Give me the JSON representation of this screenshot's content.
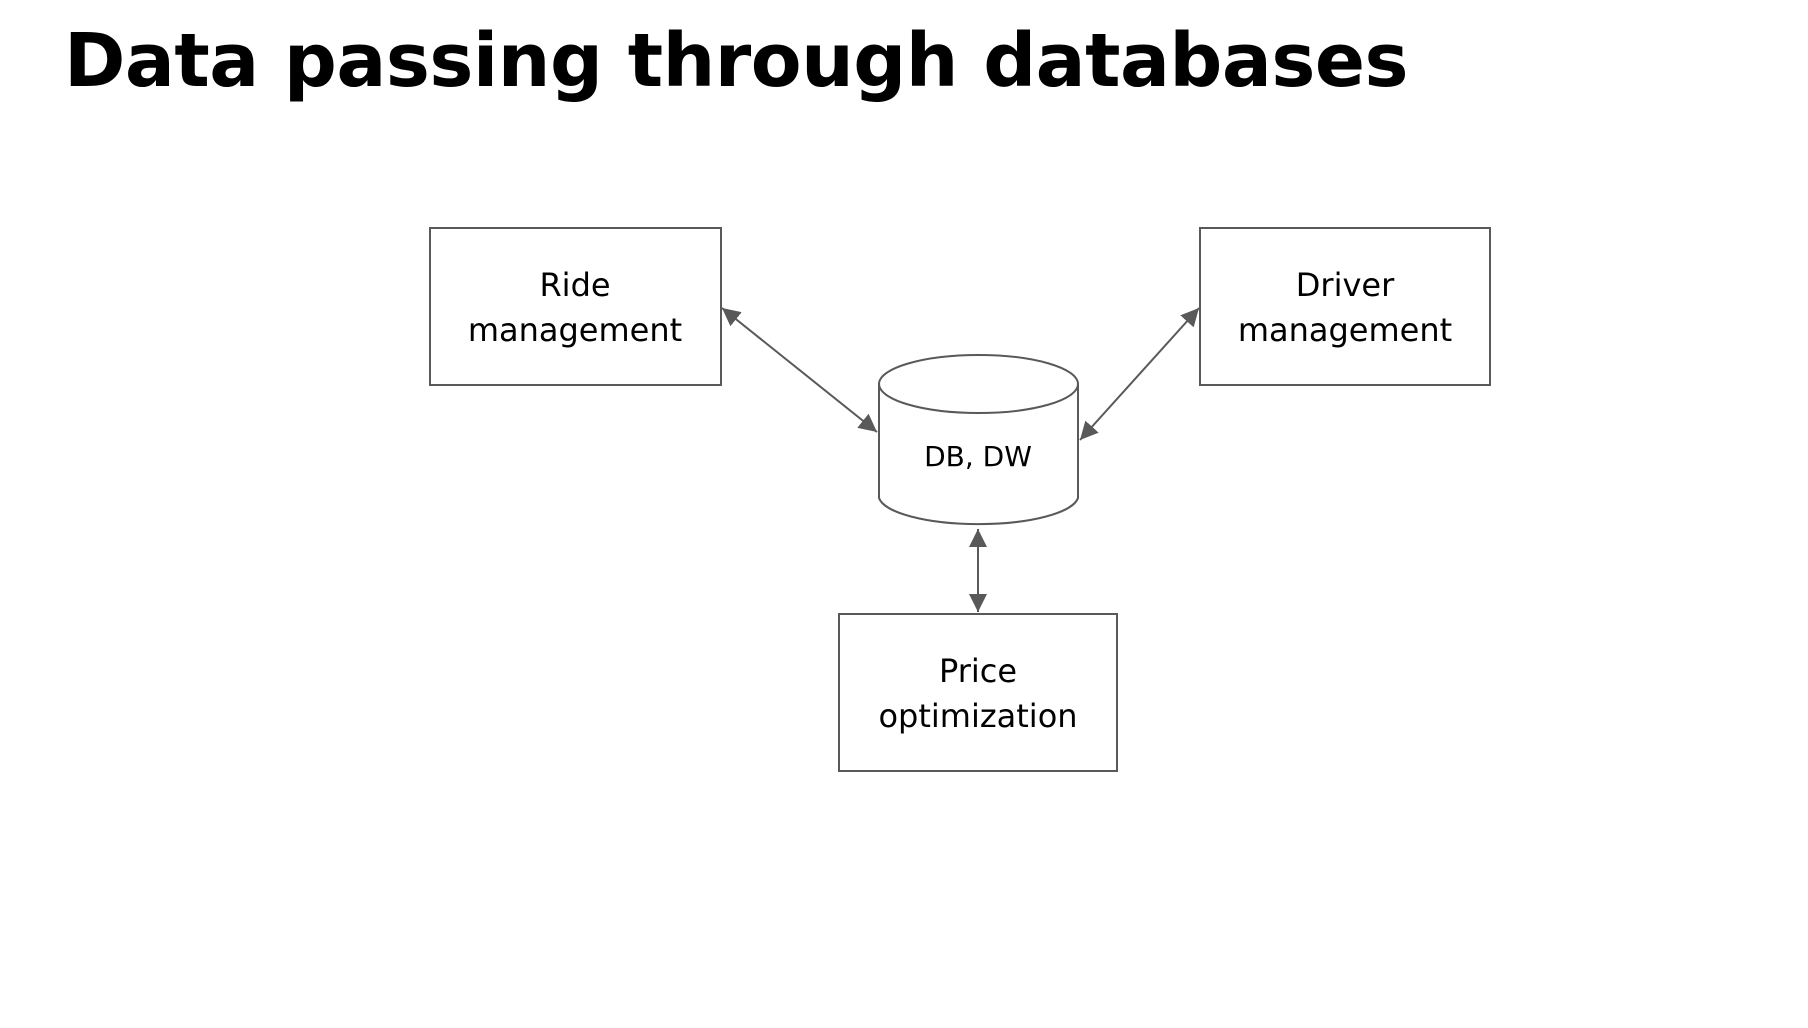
{
  "title": "Data passing through databases",
  "nodes": {
    "ride": {
      "line1": "Ride",
      "line2": "management"
    },
    "driver": {
      "line1": "Driver",
      "line2": "management"
    },
    "db": {
      "label": "DB, DW"
    },
    "price": {
      "line1": "Price",
      "line2": "optimization"
    }
  },
  "colors": {
    "stroke": "#595959",
    "text": "#000000"
  }
}
